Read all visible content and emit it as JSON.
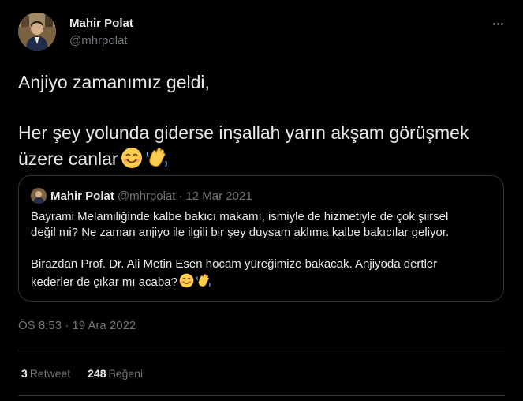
{
  "author": {
    "name": "Mahir Polat",
    "handle": "@mhrpolat"
  },
  "tweet": {
    "line1": "Anjiyo zamanımız geldi,",
    "line2a": "Her şey yolunda giderse inşallah yarın akşam görüşmek",
    "line2b": "üzere canlar",
    "emojis": [
      "smiling-face-icon",
      "waving-hand-icon"
    ]
  },
  "quote": {
    "name": "Mahir Polat",
    "handle": "@mhrpolat",
    "separator": "·",
    "date": "12 Mar 2021",
    "para1_line1": "Bayrami Melamiliğinde kalbe bakıcı makamı, ismiyle de hizmetiyle de çok şiirsel",
    "para1_line2": "değil mi? Ne zaman anjiyo ile ilgili bir şey duysam aklıma kalbe bakıcılar geliyor.",
    "para2_line1": "Birazdan Prof. Dr. Ali Metin Esen hocam yüreğimize bakacak. Anjiyoda dertler",
    "para2_line2": "kederler de çıkar mı acaba?"
  },
  "timestamp": "ÖS 8:53 · 19 Ara 2022",
  "stats": {
    "retweets_count": "3",
    "retweets_label": "Retweet",
    "likes_count": "248",
    "likes_label": "Beğeni"
  },
  "colors": {
    "background": "#000000",
    "text_primary": "#e7e9ea",
    "text_secondary": "#71767b",
    "border": "#2f3336"
  }
}
